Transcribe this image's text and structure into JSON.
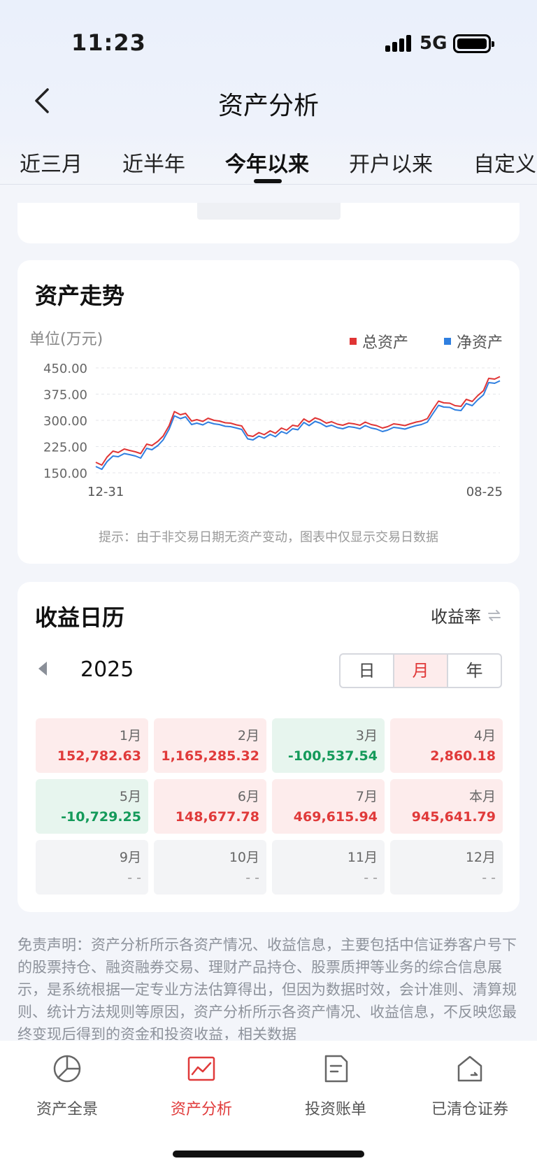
{
  "status_bar": {
    "time": "11:23",
    "network": "5G"
  },
  "nav": {
    "title": "资产分析"
  },
  "tabs": [
    {
      "label": "近三月",
      "active": false
    },
    {
      "label": "近半年",
      "active": false
    },
    {
      "label": "今年以来",
      "active": true
    },
    {
      "label": "开户以来",
      "active": false
    },
    {
      "label": "自定义",
      "active": false
    }
  ],
  "chart_card": {
    "title": "资产走势",
    "unit": "单位(万元)",
    "tip": "提示：由于非交易日期无资产变动，图表中仅显示交易日数据"
  },
  "chart_data": {
    "type": "line",
    "ylim": [
      150,
      450
    ],
    "y_ticks": [
      "450.00",
      "375.00",
      "300.00",
      "225.00",
      "150.00"
    ],
    "x_ticks": [
      "12-31",
      "08-25"
    ],
    "grid": true,
    "legend_position": "top-right",
    "x": [
      0,
      8,
      15,
      23,
      30,
      38,
      45,
      53,
      60,
      68,
      75,
      83,
      90,
      98,
      105,
      113,
      120,
      128,
      135,
      143,
      150,
      158,
      165,
      173,
      180,
      188,
      195,
      203,
      210,
      218,
      225,
      233,
      240,
      248,
      255,
      263,
      270,
      278,
      285,
      293,
      300,
      308,
      315,
      323,
      330,
      338,
      345,
      353,
      360,
      368,
      375,
      383,
      390,
      398,
      405,
      413,
      420,
      428,
      435,
      443,
      450,
      458,
      465,
      473,
      480,
      488,
      495,
      503,
      510,
      518,
      525,
      533,
      540
    ],
    "series": [
      {
        "name": "总资产",
        "color": "#e03535",
        "values": [
          180,
          172,
          195,
          212,
          208,
          218,
          214,
          210,
          205,
          232,
          228,
          240,
          255,
          285,
          325,
          316,
          320,
          298,
          302,
          297,
          306,
          300,
          298,
          293,
          292,
          287,
          284,
          257,
          254,
          265,
          259,
          270,
          263,
          278,
          272,
          286,
          283,
          304,
          295,
          307,
          302,
          292,
          296,
          289,
          286,
          292,
          290,
          286,
          295,
          288,
          285,
          278,
          282,
          290,
          288,
          285,
          290,
          295,
          298,
          305,
          330,
          355,
          350,
          349,
          342,
          340,
          360,
          354,
          370,
          385,
          420,
          418,
          425
        ]
      },
      {
        "name": "净资产",
        "color": "#2f7fe0",
        "values": [
          168,
          160,
          182,
          198,
          196,
          205,
          202,
          198,
          192,
          220,
          216,
          228,
          244,
          275,
          313,
          305,
          310,
          288,
          292,
          287,
          295,
          290,
          288,
          283,
          282,
          278,
          274,
          247,
          244,
          255,
          249,
          260,
          253,
          268,
          262,
          276,
          273,
          294,
          285,
          297,
          292,
          282,
          286,
          279,
          276,
          282,
          280,
          276,
          285,
          278,
          275,
          268,
          272,
          280,
          278,
          275,
          280,
          285,
          288,
          295,
          318,
          343,
          338,
          337,
          330,
          328,
          348,
          342,
          358,
          373,
          408,
          406,
          413
        ]
      }
    ]
  },
  "calendar_card": {
    "title": "收益日历",
    "yield_toggle": "收益率",
    "year": "2025",
    "segments": [
      {
        "label": "日",
        "active": false
      },
      {
        "label": "月",
        "active": true
      },
      {
        "label": "年",
        "active": false
      }
    ],
    "months": [
      {
        "month": "1月",
        "value": "152,782.63",
        "trend": "pos"
      },
      {
        "month": "2月",
        "value": "1,165,285.32",
        "trend": "pos"
      },
      {
        "month": "3月",
        "value": "-100,537.54",
        "trend": "neg"
      },
      {
        "month": "4月",
        "value": "2,860.18",
        "trend": "pos"
      },
      {
        "month": "5月",
        "value": "-10,729.25",
        "trend": "neg"
      },
      {
        "month": "6月",
        "value": "148,677.78",
        "trend": "pos"
      },
      {
        "month": "7月",
        "value": "469,615.94",
        "trend": "pos"
      },
      {
        "month": "本月",
        "value": "945,641.79",
        "trend": "pos"
      },
      {
        "month": "9月",
        "value": "- -",
        "trend": "none"
      },
      {
        "month": "10月",
        "value": "- -",
        "trend": "none"
      },
      {
        "month": "11月",
        "value": "- -",
        "trend": "none"
      },
      {
        "month": "12月",
        "value": "- -",
        "trend": "none"
      }
    ]
  },
  "disclaimer": "免责声明：资产分析所示各资产情况、收益信息，主要包括中信证券客户号下的股票持仓、融资融券交易、理财产品持仓、股票质押等业务的综合信息展示，是系统根据一定专业方法估算得出，但因为数据时效，会计准则、清算规则、统计方法规则等原因，资产分析所示各资产情况、收益信息，不反映您最终变现后得到的资金和投资收益，相关数据",
  "bottom_nav": [
    {
      "label": "资产全景",
      "icon": "pie-chart-icon",
      "active": false
    },
    {
      "label": "资产分析",
      "icon": "trend-chart-icon",
      "active": true
    },
    {
      "label": "投资账单",
      "icon": "bill-document-icon",
      "active": false
    },
    {
      "label": "已清仓证券",
      "icon": "cleared-stock-icon",
      "active": false
    }
  ],
  "colors": {
    "accent": "#e03a3a",
    "positive": "#e03a3a",
    "negative": "#149a5a"
  }
}
